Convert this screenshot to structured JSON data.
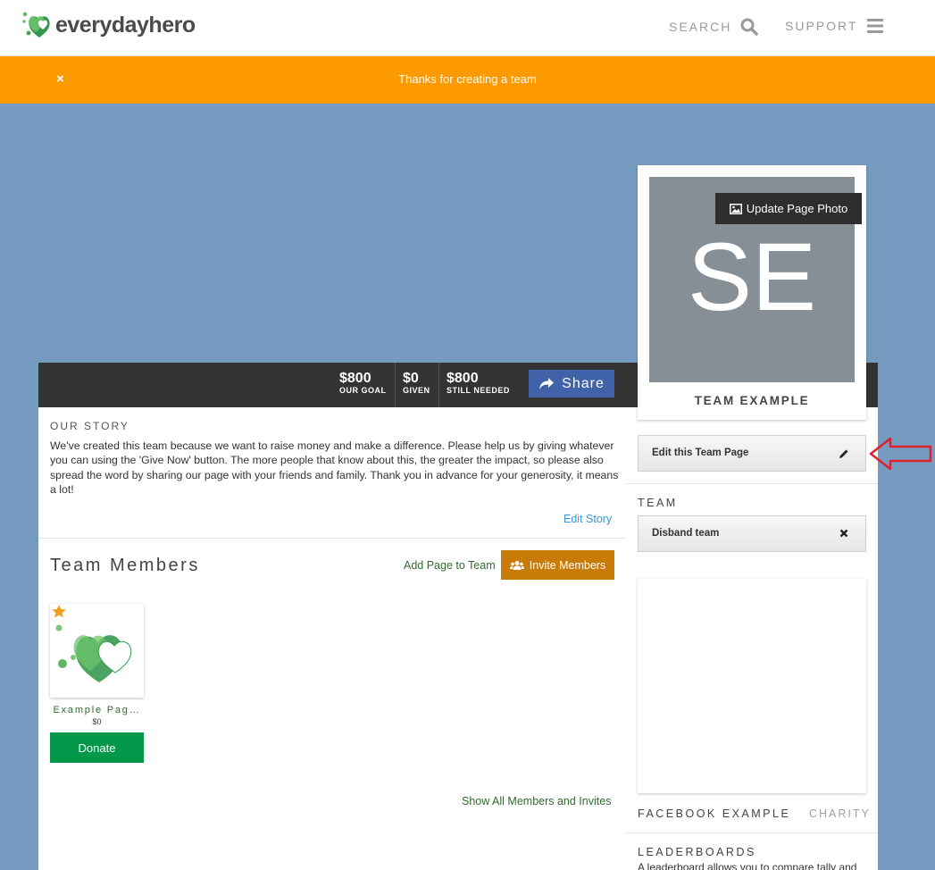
{
  "header": {
    "logo_text": "everydayhero",
    "search_label": "SEARCH",
    "support_label": "SUPPORT"
  },
  "banner": {
    "close_glyph": "×",
    "message": "Thanks for creating a team"
  },
  "stats": [
    {
      "value": "$800",
      "label": "OUR GOAL"
    },
    {
      "value": "$0",
      "label": "GIVEN"
    },
    {
      "value": "$800",
      "label": "STILL NEEDED"
    }
  ],
  "share_label": "Share",
  "story": {
    "heading": "OUR STORY",
    "body": "We've created this team because we want to raise money and make a difference. Please help us by giving whatever you can using the 'Give Now' button. The more people that know about this, the greater the impact, so please also spread the word by sharing our page with your friends and family. Thank you in advance for your generosity, it means a lot!",
    "edit_label": "Edit Story"
  },
  "members": {
    "heading": "Team Members",
    "add_page_label": "Add Page to Team",
    "invite_label": "Invite Members",
    "list": [
      {
        "name": "Example Pag…",
        "amount": "$0",
        "donate_label": "Donate"
      }
    ],
    "show_all_label": "Show All Members and Invites"
  },
  "sidebar": {
    "photo_initials": "SE",
    "update_photo_label": "Update Page Photo",
    "team_name": "TEAM EXAMPLE",
    "edit_team_label": "Edit this Team Page",
    "team_heading": "TEAM",
    "disband_label": "Disband team",
    "facebook_heading": "FACEBOOK EXAMPLE",
    "charity_label": "CHARITY",
    "leaderboards_heading": "LEADERBOARDS",
    "leaderboards_text": "A leaderboard allows you to compare tally and"
  },
  "colors": {
    "background": "#759bc1",
    "banner": "#fd9a00",
    "stats_bar": "#333333",
    "share": "#3f62a8",
    "invite": "#c97b07",
    "donate": "#03974a",
    "annotation_arrow": "#e0202a"
  },
  "icons": {
    "logo": "heart-logo-icon",
    "search": "search-icon",
    "menu": "hamburger-menu-icon",
    "share": "share-arrow-icon",
    "invite": "group-icon",
    "photo": "image-icon",
    "edit": "pencil-icon",
    "disband": "close-icon",
    "member_badge": "star-icon",
    "annotation": "left-arrow-annotation-icon"
  }
}
